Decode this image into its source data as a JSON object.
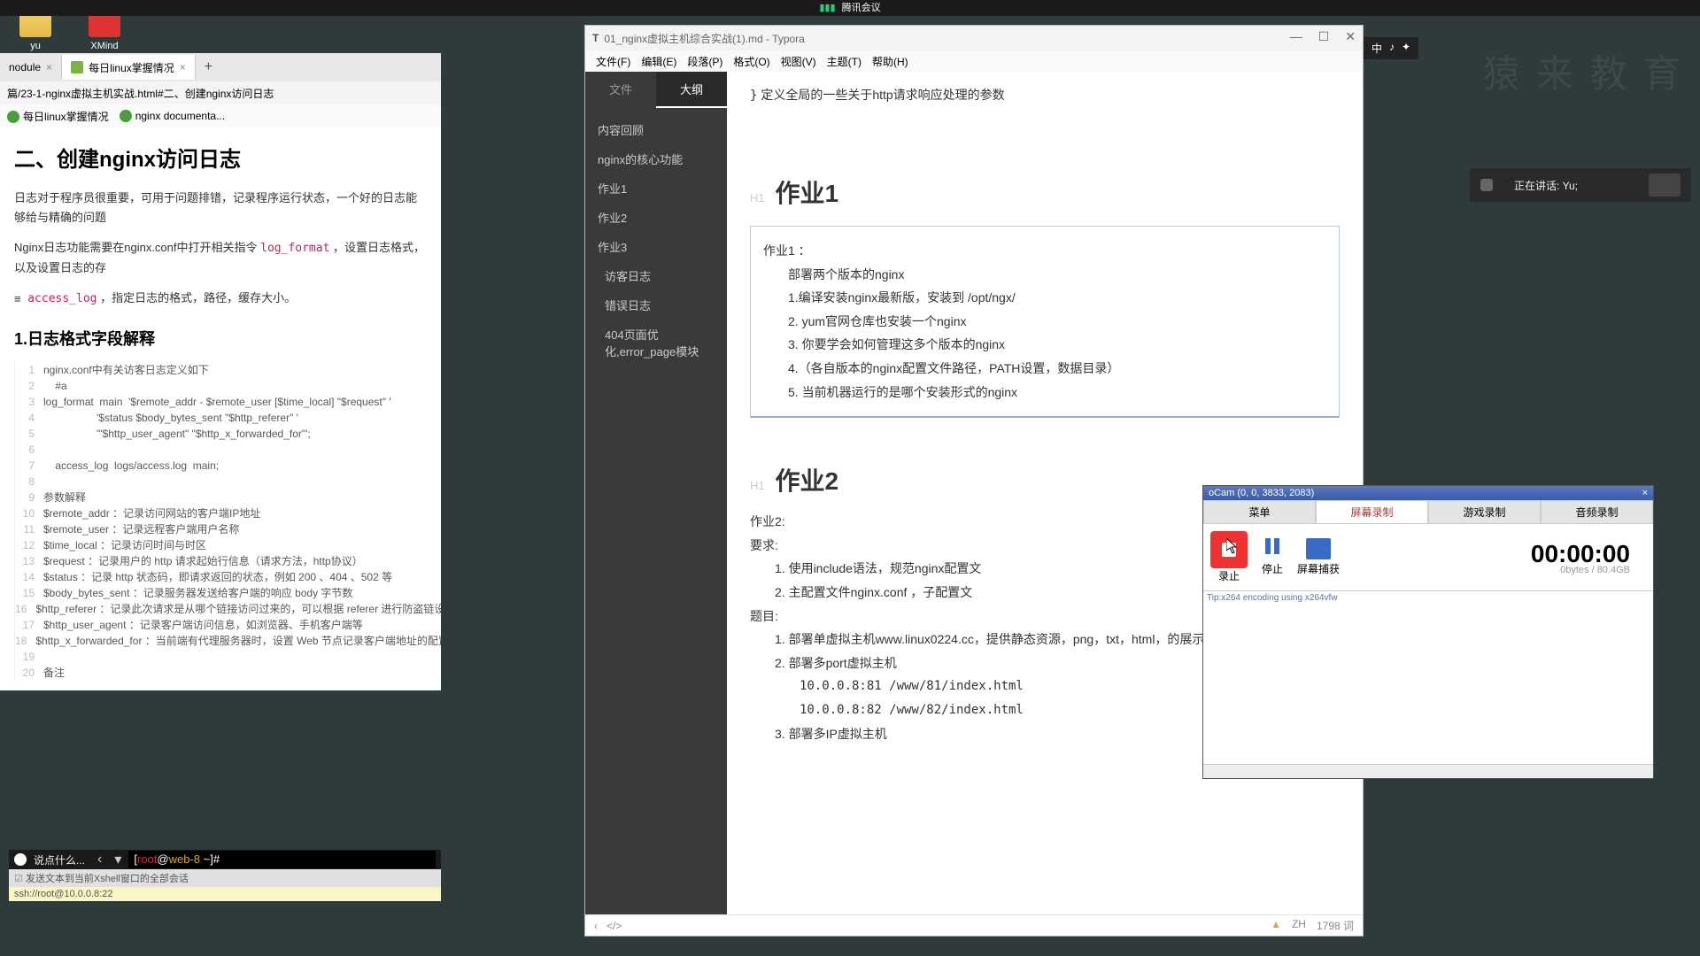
{
  "desktop": {
    "icon1": "yu",
    "icon2": "XMind"
  },
  "topbar": {
    "app": "腾讯会议"
  },
  "browser": {
    "tab1": "nodule",
    "tab2": "每日linux掌握情况",
    "addr": "篇/23-1-nginx虚拟主机实战.html#二、创建nginx访问日志",
    "bm1": "每日linux掌握情况",
    "bm2": "nginx documenta..."
  },
  "page": {
    "h2": "二、创建nginx访问日志",
    "p1a": "日志对于程序员很重要，可用于问题排错，记录程序运行状态，一个好的日志能够给与精确的问题",
    "p2a": "Nginx日志功能需要在nginx.conf中打开相关指令 ",
    "p2code": "log_format",
    "p2b": " ，设置日志格式，以及设置日志的存",
    "p3code": "access_log",
    "p3b": " ，指定日志的格式，路径，缓存大小。",
    "h3": "1.日志格式字段解释",
    "code": [
      {
        "n": "1",
        "t": "nginx.conf中有关访客日志定义如下"
      },
      {
        "n": "2",
        "t": "    #a"
      },
      {
        "n": "3",
        "t": "log_format  main  '$remote_addr - $remote_user [$time_local] \"$request\" '"
      },
      {
        "n": "4",
        "t": "                  '$status $body_bytes_sent \"$http_referer\" '"
      },
      {
        "n": "5",
        "t": "                  '\"$http_user_agent\" \"$http_x_forwarded_for\"';"
      },
      {
        "n": "6",
        "t": ""
      },
      {
        "n": "7",
        "t": "    access_log  logs/access.log  main;"
      },
      {
        "n": "8",
        "t": ""
      },
      {
        "n": "9",
        "t": "参数解释"
      },
      {
        "n": "10",
        "t": "$remote_addr ：记录访问网站的客户端IP地址"
      },
      {
        "n": "11",
        "t": "$remote_user ：记录远程客户端用户名称"
      },
      {
        "n": "12",
        "t": "$time_local ：记录访问时间与时区"
      },
      {
        "n": "13",
        "t": "$request ：记录用户的 http 请求起始行信息（请求方法，http协议）"
      },
      {
        "n": "14",
        "t": "$status ：记录 http 状态码，即请求返回的状态，例如 200 、404 、502 等"
      },
      {
        "n": "15",
        "t": "$body_bytes_sent ：记录服务器发送给客户端的响应 body 字节数"
      },
      {
        "n": "16",
        "t": "$http_referer ：记录此次请求是从哪个链接访问过来的，可以根据 referer 进行防盗链设置"
      },
      {
        "n": "17",
        "t": "$http_user_agent ：记录客户端访问信息，如浏览器、手机客户端等"
      },
      {
        "n": "18",
        "t": "$http_x_forwarded_for ：当前端有代理服务器时，设置 Web 节点记录客户端地址的配置，此参数生效的前提"
      },
      {
        "n": "19",
        "t": ""
      },
      {
        "n": "20",
        "t": "备注"
      }
    ]
  },
  "terminal": {
    "say": "说点什么...",
    "prompt_open": "[",
    "prompt_user": "root",
    "prompt_at": "@",
    "prompt_host": "web-8",
    "prompt_end": " ~]#",
    "hint": "发送文本到当前Xshell窗口的全部会话",
    "status": "ssh://root@10.0.0.8:22"
  },
  "typora": {
    "title": "01_nginx虚拟主机综合实战(1).md - Typora",
    "menu": [
      "文件(F)",
      "编辑(E)",
      "段落(P)",
      "格式(O)",
      "视图(V)",
      "主题(T)",
      "帮助(H)"
    ],
    "sidebar": {
      "tab1": "文件",
      "tab2": "大纲",
      "items": [
        "内容回顾",
        "nginx的核心功能",
        "作业1",
        "作业2",
        "作业3",
        "访客日志",
        "错误日志",
        "404页面优化,error_page模块"
      ]
    },
    "globalNote": "定义全局的一些关于http请求响应处理的参数",
    "task1": {
      "title": "作业1",
      "l0": "作业1 ：",
      "l1": "部署两个版本的nginx",
      "l2": "1.编译安装nginx最新版，安装到 /opt/ngx/",
      "l3": "2. yum官网仓库也安装一个nginx",
      "l4": "3. 你要学会如何管理这多个版本的nginx",
      "l5": "4.（各自版本的nginx配置文件路径，PATH设置，数据目录）",
      "l6": "5. 当前机器运行的是哪个安装形式的nginx"
    },
    "task2": {
      "title": "作业2",
      "l0": "作业2:",
      "l1": "要求:",
      "l2": "1. 使用include语法，规范nginx配置文",
      "l3": "2. 主配置文件nginx.conf ，子配置文",
      "l4": "题目:",
      "l5": "1. 部署单虚拟主机www.linux0224.cc，提供静态资源，png，txt，html，的展示",
      "l6": "2. 部署多port虚拟主机",
      "l7": "   10.0.0.8:81   /www/81/index.html",
      "l8": "   10.0.0.8:82   /www/82/index.html",
      "l9": "3. 部署多IP虚拟主机"
    },
    "status": {
      "lang": "ZH",
      "words": "1798 词"
    }
  },
  "ime": {
    "a": "中",
    "b": "♪",
    "c": "✦"
  },
  "speaking": {
    "label": "正在讲话: Yu;"
  },
  "watermark": "猿 来 教 育",
  "ocam": {
    "title": "oCam (0, 0, 3833, 2083)",
    "tabs": [
      "菜单",
      "屏幕录制",
      "游戏录制",
      "音频录制"
    ],
    "btn_rec": "录止",
    "btn_pause": "停止",
    "btn_cap": "屏幕捕获",
    "timer": "00:00:00",
    "sub": "0bytes / 80.4GB",
    "log": "Tip:x264 encoding using x264vfw"
  }
}
